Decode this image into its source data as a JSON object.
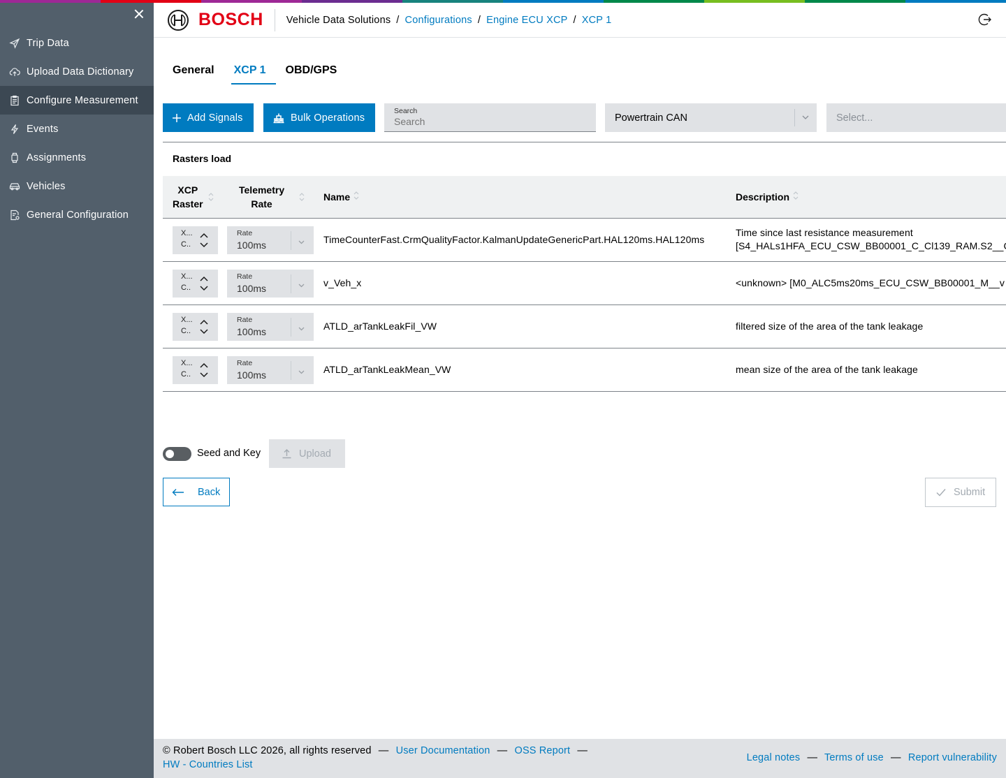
{
  "colors": {
    "accent": "#007bc0",
    "brand_red": "#e20015",
    "sidebar_bg": "#525f6b",
    "sidebar_active_bg": "#3c4853",
    "top_band": [
      "#9e2896",
      "#e20015",
      "#9e2896",
      "#6b2c90",
      "#18837e",
      "#007bc0",
      "#00884a",
      "#78be20",
      "#00884a",
      "#007bc0"
    ]
  },
  "sidebar": {
    "close_icon": "close-icon",
    "items": [
      {
        "label": "Trip Data",
        "icon": "send-icon"
      },
      {
        "label": "Upload Data Dictionary",
        "icon": "cloud-upload-icon"
      },
      {
        "label": "Configure Measurement",
        "icon": "clipboard-icon",
        "active": true
      },
      {
        "label": "Events",
        "icon": "lightning-icon"
      },
      {
        "label": "Assignments",
        "icon": "watch-icon"
      },
      {
        "label": "Vehicles",
        "icon": "car-icon"
      },
      {
        "label": "General Configuration",
        "icon": "document-settings-icon"
      }
    ]
  },
  "header": {
    "brand": "BOSCH",
    "breadcrumb": {
      "root": "Vehicle Data Solutions",
      "items": [
        "Configurations",
        "Engine ECU XCP",
        "XCP 1"
      ],
      "separator": "/"
    },
    "logout_icon": "logout-icon"
  },
  "tabs": [
    "General",
    "XCP 1",
    "OBD/GPS"
  ],
  "active_tab": "XCP 1",
  "toolbar": {
    "add_signals": "Add Signals",
    "bulk_operations": "Bulk Operations",
    "search_label": "Search",
    "search_placeholder": "Search",
    "bus_select": "Powertrain CAN",
    "second_select_placeholder": "Select..."
  },
  "section_title": "Rasters load",
  "table": {
    "columns": {
      "xcp_raster_line1": "XCP",
      "xcp_raster_line2": "Raster",
      "telemetry_rate_line1": "Telemetry",
      "telemetry_rate_line2": "Rate",
      "name": "Name",
      "description": "Description"
    },
    "rows": [
      {
        "raster_line1": "X...",
        "raster_line2": "C..",
        "rate_label": "Rate",
        "rate_value": "100ms",
        "name": "TimeCounterFast.CrmQualityFactor.KalmanUpdateGenericPart.HAL120ms.HAL120ms",
        "description_line1": "Time since last resistance measurement",
        "description_line2": "[S4_HALs1HFA_ECU_CSW_BB00001_C_Cl139_RAM.S2__C_"
      },
      {
        "raster_line1": "X...",
        "raster_line2": "C..",
        "rate_label": "Rate",
        "rate_value": "100ms",
        "name": "v_Veh_x",
        "description_line1": "<unknown> [M0_ALC5ms20ms_ECU_CSW_BB00001_M__v",
        "description_line2": ""
      },
      {
        "raster_line1": "X...",
        "raster_line2": "C..",
        "rate_label": "Rate",
        "rate_value": "100ms",
        "name": "ATLD_arTankLeakFil_VW",
        "description_line1": "filtered size of the area of the tank leakage",
        "description_line2": ""
      },
      {
        "raster_line1": "X...",
        "raster_line2": "C..",
        "rate_label": "Rate",
        "rate_value": "100ms",
        "name": "ATLD_arTankLeakMean_VW",
        "description_line1": "mean size of the area of the tank leakage",
        "description_line2": ""
      }
    ]
  },
  "seed_and_key": {
    "label": "Seed and Key",
    "enabled": false
  },
  "upload_label": "Upload",
  "back_label": "Back",
  "submit_label": "Submit",
  "footer": {
    "copyright": "© Robert Bosch LLC 2026, all rights reserved",
    "user_documentation": "User Documentation",
    "oss_report": "OSS Report",
    "hw_countries": "HW - Countries List",
    "legal_notes": "Legal notes",
    "terms_of_use": "Terms of use",
    "report_vulnerability": "Report vulnerability",
    "dash": "—"
  }
}
